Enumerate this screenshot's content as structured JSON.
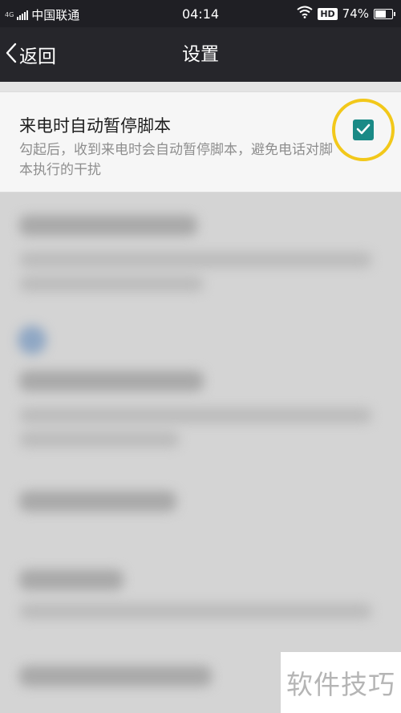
{
  "status_bar": {
    "network_type": "4G",
    "carrier": "中国联通",
    "time": "04:14",
    "hd_badge": "HD",
    "battery": "74%",
    "battery_level": 0.74
  },
  "nav": {
    "back_label": "返回",
    "title": "设置"
  },
  "setting": {
    "title": "来电时自动暂停脚本",
    "description": "勾起后，收到来电时会自动暂停脚本，避免电话对脚本执行的干扰",
    "checked": true,
    "check_color": "#1a8a86",
    "highlight_color": "#f2c81a"
  },
  "watermark": "软件技巧"
}
